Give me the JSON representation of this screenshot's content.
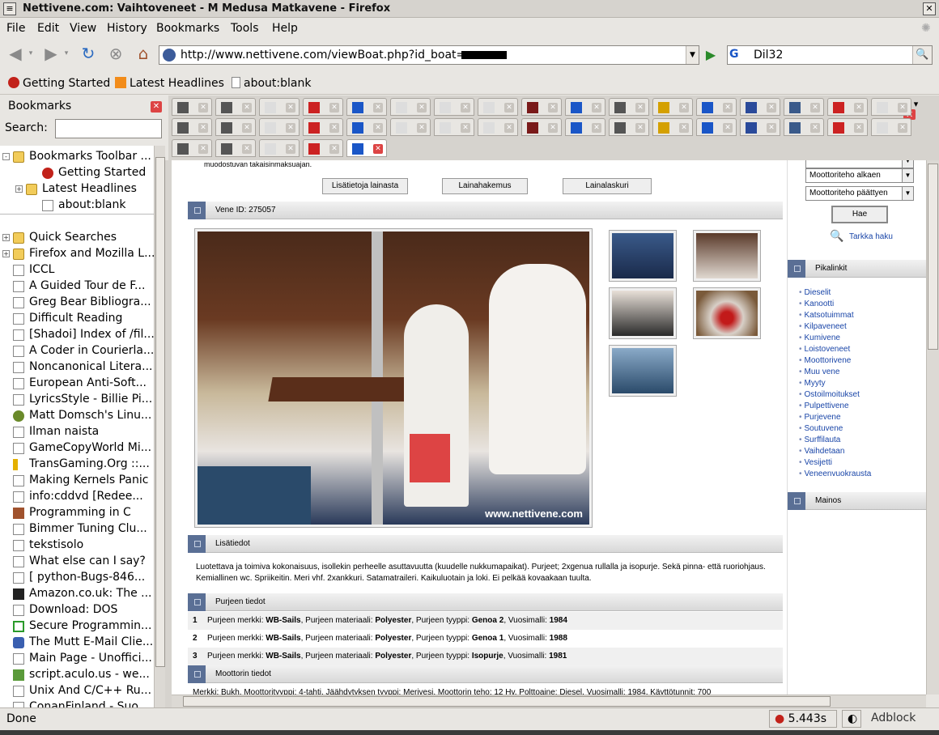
{
  "window": {
    "title": "Nettivene.com: Vaihtoveneet - M Medusa Matkavene - Firefox"
  },
  "menu": [
    "File",
    "Edit",
    "View",
    "History",
    "Bookmarks",
    "Tools",
    "Help"
  ],
  "url": {
    "value": "http://www.nettivene.com/viewBoat.php?id_boat="
  },
  "search": {
    "engine": "G",
    "value": "Dil32"
  },
  "bookmarks_toolbar": [
    "Getting Started",
    "Latest Headlines",
    "about:blank"
  ],
  "sidebar": {
    "title": "Bookmarks",
    "search_label": "Search:",
    "items": [
      {
        "label": "Bookmarks Toolbar ...",
        "type": "folder",
        "expander": "-",
        "level": 0
      },
      {
        "label": "Getting Started",
        "type": "red",
        "level": 2
      },
      {
        "label": "Latest Headlines",
        "type": "folder",
        "expander": "+",
        "level": 1
      },
      {
        "label": "about:blank",
        "type": "page",
        "level": 2
      },
      {
        "label": "Quick Searches",
        "type": "folder",
        "expander": "+",
        "level": 0
      },
      {
        "label": "Firefox and Mozilla L...",
        "type": "folder",
        "expander": "+",
        "level": 0
      },
      {
        "label": "ICCL",
        "type": "page",
        "level": 0
      },
      {
        "label": "A Guided Tour de F...",
        "type": "page",
        "level": 0
      },
      {
        "label": "Greg Bear Bibliogra...",
        "type": "page",
        "level": 0
      },
      {
        "label": "Difficult Reading",
        "type": "page",
        "level": 0
      },
      {
        "label": "[Shadoi] Index of /fil...",
        "type": "page",
        "level": 0
      },
      {
        "label": "A Coder in Courierla...",
        "type": "page",
        "level": 0
      },
      {
        "label": "Noncanonical Litera...",
        "type": "page",
        "level": 0
      },
      {
        "label": "European Anti-Soft...",
        "type": "page",
        "level": 0
      },
      {
        "label": "LyricsStyle - Billie Pi...",
        "type": "page",
        "level": 0
      },
      {
        "label": "Matt Domsch's Linu...",
        "type": "gear",
        "level": 0
      },
      {
        "label": "Ilman naista",
        "type": "page",
        "level": 0
      },
      {
        "label": "GameCopyWorld Mi...",
        "type": "page",
        "level": 0
      },
      {
        "label": "TransGaming.Org ::...",
        "type": "trans",
        "level": 0
      },
      {
        "label": "Making Kernels Panic",
        "type": "page",
        "level": 0
      },
      {
        "label": "info:cddvd [Redee...",
        "type": "page",
        "level": 0
      },
      {
        "label": "Programming in C",
        "type": "s",
        "level": 0
      },
      {
        "label": "Bimmer Tuning Clu...",
        "type": "page",
        "level": 0
      },
      {
        "label": "tekstisolo",
        "type": "page",
        "level": 0
      },
      {
        "label": "What else can I say?",
        "type": "page",
        "level": 0
      },
      {
        "label": "[ python-Bugs-846...",
        "type": "page",
        "level": 0
      },
      {
        "label": "Amazon.co.uk: The ...",
        "type": "amz",
        "level": 0
      },
      {
        "label": "Download: DOS",
        "type": "page",
        "level": 0
      },
      {
        "label": "Secure Programmin...",
        "type": "dgreen",
        "level": 0
      },
      {
        "label": "The Mutt E-Mail Clie...",
        "type": "mutt",
        "level": 0
      },
      {
        "label": "Main Page - Unoffici...",
        "type": "page",
        "level": 0
      },
      {
        "label": "script.aculo.us - we...",
        "type": "sc",
        "level": 0
      },
      {
        "label": "Unix And C/C++ Ru...",
        "type": "page",
        "level": 0
      },
      {
        "label": "ConanFinland - Suo...",
        "type": "page",
        "level": 0
      }
    ]
  },
  "page": {
    "top_text": "muodostuvan takaisinmaksuajan.",
    "buttons": [
      "Lisätietoja lainasta",
      "Lainahakemus",
      "Lainalaskuri"
    ],
    "boat_id": "Vene ID: 275057",
    "watermark": "www.nettivene.com",
    "details_title": "Lisätiedot",
    "details_text": "Luotettava ja toimiva kokonaisuus, isollekin perheelle asuttavuutta (kuudelle nukkumapaikat). Purjeet; 2xgenua rullalla ja isopurje. Sekä pinna- että ruoriohjaus. Kemiallinen wc. Spriikeitin. Meri vhf. 2xankkuri. Satamatraileri. Kaikuluotain ja loki. Ei pelkää kovaakaan tuulta.",
    "sails_title": "Purjeen tiedot",
    "sails": [
      {
        "n": "1",
        "brand": "WB-Sails",
        "material": "Polyester",
        "type": "Genoa 2",
        "year": "1984"
      },
      {
        "n": "2",
        "brand": "WB-Sails",
        "material": "Polyester",
        "type": "Genoa 1",
        "year": "1988"
      },
      {
        "n": "3",
        "brand": "WB-Sails",
        "material": "Polyester",
        "type": "Isopurje",
        "year": "1981"
      }
    ],
    "sail_labels": {
      "brand": "Purjeen merkki:",
      "material": "Purjeen materiaali:",
      "type": "Purjeen tyyppi:",
      "year": "Vuosimalli:"
    },
    "engine_title": "Moottorin tiedot",
    "engine_line": "Merkki: Bukh, Moottorityyppi: 4-tahti, Jäähdytyksen tyyppi: Merivesi, Moottorin teho: 12 Hv, Polttoaine: Diesel, Vuosimalli: 1984, Käyttötunnit: 700"
  },
  "right": {
    "select0": "Moottoriteho alkaen",
    "select1": "Moottoriteho päättyen",
    "search_btn": "Hae",
    "advanced": "Tarkka haku",
    "pikalinkit_title": "Pikalinkit",
    "links": [
      "Dieselit",
      "Kanootti",
      "Katsotuimmat",
      "Kilpaveneet",
      "Kumivene",
      "Loistoveneet",
      "Moottorivene",
      "Muu vene",
      "Myyty",
      "Ostoilmoitukset",
      "Pulpettivene",
      "Purjevene",
      "Soutuvene",
      "Surffilauta",
      "Vaihdetaan",
      "Vesijetti",
      "Veneenvuokrausta"
    ],
    "ad_title": "Mainos"
  },
  "status": {
    "text": "Done",
    "time": "5.443s",
    "adblock": "Adblock"
  }
}
